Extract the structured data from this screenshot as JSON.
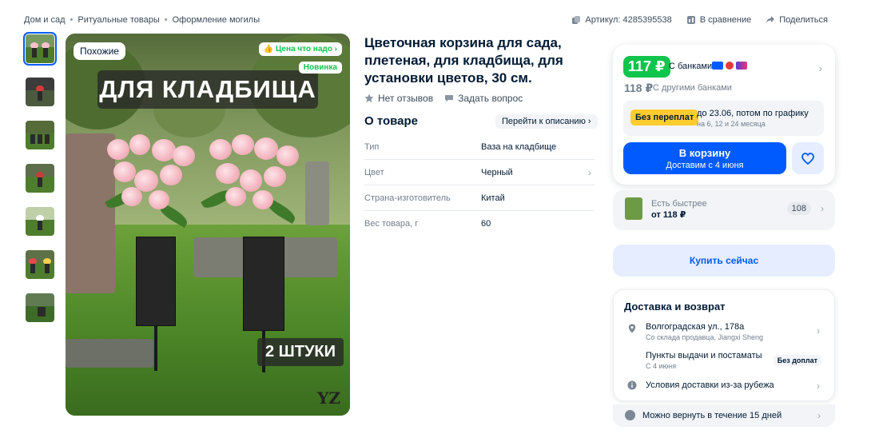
{
  "breadcrumbs": [
    "Дом и сад",
    "Ритуальные товары",
    "Оформление могилы"
  ],
  "top_actions": {
    "article": "Артикул: 4285395538",
    "compare": "В сравнение",
    "share": "Поделиться"
  },
  "gallery": {
    "thumbnail_count": 7,
    "selected_index": 0,
    "badges": {
      "similar": "Похожие",
      "good_price": "Цена что надо",
      "new": "Новинка"
    },
    "banner": "ДЛЯ КЛАДБИЩА",
    "quantity": "2 ШТУКИ",
    "logo": "YZ"
  },
  "product": {
    "title": "Цветочная корзина для сада, плетеная, для кладбища, для установки цветов, 30 см.",
    "reviews": "Нет отзывов",
    "ask_question": "Задать вопрос"
  },
  "about": {
    "heading": "О товаре",
    "to_description": "Перейти к описанию",
    "properties": [
      {
        "key": "Тип",
        "value": "Ваза на кладбище"
      },
      {
        "key": "Цвет",
        "value": "Черный"
      },
      {
        "key": "Страна-изготовитель",
        "value": "Китай"
      },
      {
        "key": "Вес товара, г",
        "value": "60"
      }
    ]
  },
  "price_card": {
    "price_with_banks": "117 ₽",
    "with_banks_label": "С банками",
    "price_other": "118 ₽",
    "other_banks_label": "С другими банками",
    "no_overpay": "Без переплат",
    "installment_line1": "до 23.06, потом по графику",
    "installment_line2": "на 6, 12 и 24 месяца",
    "cart_button": "В корзину",
    "cart_delivery": "Доставим с 4 июня"
  },
  "faster": {
    "label": "Есть быстрее",
    "price": "от 118 ₽",
    "count": "108"
  },
  "buy_now": "Купить сейчас",
  "delivery": {
    "heading": "Доставка и возврат",
    "address": "Волгоградская ул., 178а",
    "address_sub": "Со склада продавца, Jiangxi Sheng",
    "pickup": "Пункты выдачи и постаматы",
    "pickup_sub": "С 4 июня",
    "pickup_badge": "Без доплат",
    "abroad": "Условия доставки из-за рубежа",
    "return": "Можно вернуть в течение 15 дней"
  },
  "colors": {
    "accent": "#005bff",
    "green": "#10c44c",
    "yellow": "#ffcc2f"
  }
}
